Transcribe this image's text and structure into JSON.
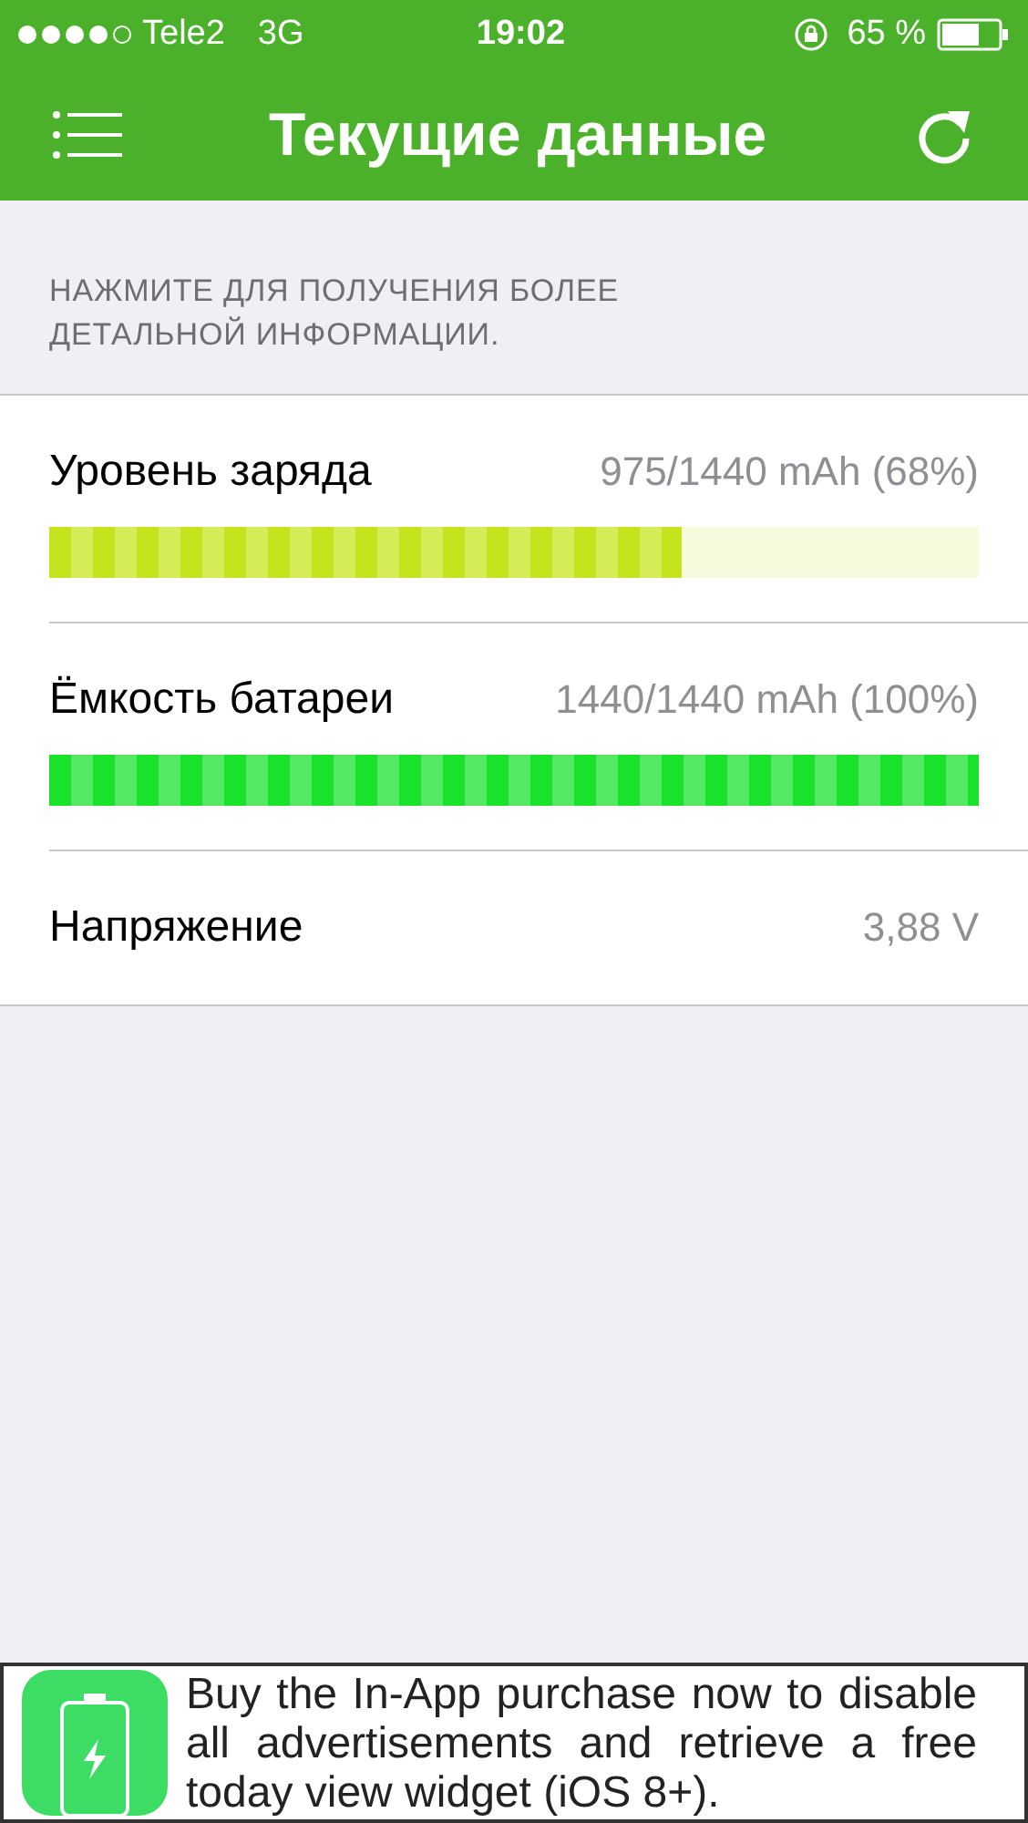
{
  "status_bar": {
    "carrier": "Tele2",
    "network": "3G",
    "time": "19:02",
    "battery_percent": "65 %"
  },
  "nav_bar": {
    "title": "Текущие данные"
  },
  "section_header": "НАЖМИТЕ ДЛЯ ПОЛУЧЕНИЯ БОЛЕЕ ДЕТАЛЬНОЙ ИНФОРМАЦИИ.",
  "rows": [
    {
      "kind": "bar",
      "label": "Уровень заряда",
      "value": "975/1440 mAh (68%)",
      "level": 0.68,
      "color": "#c6e41e"
    },
    {
      "kind": "bar",
      "label": "Ёмкость батареи",
      "value": "1440/1440 mAh (100%)",
      "level": 1,
      "color": "#19e12c"
    },
    {
      "kind": "plain",
      "label": "Напряжение",
      "value": "3,88 V"
    }
  ],
  "ad": {
    "text": "Buy the In-App purchase now to disable all advertisements and retrieve a free today view widget (iOS 8+)."
  }
}
